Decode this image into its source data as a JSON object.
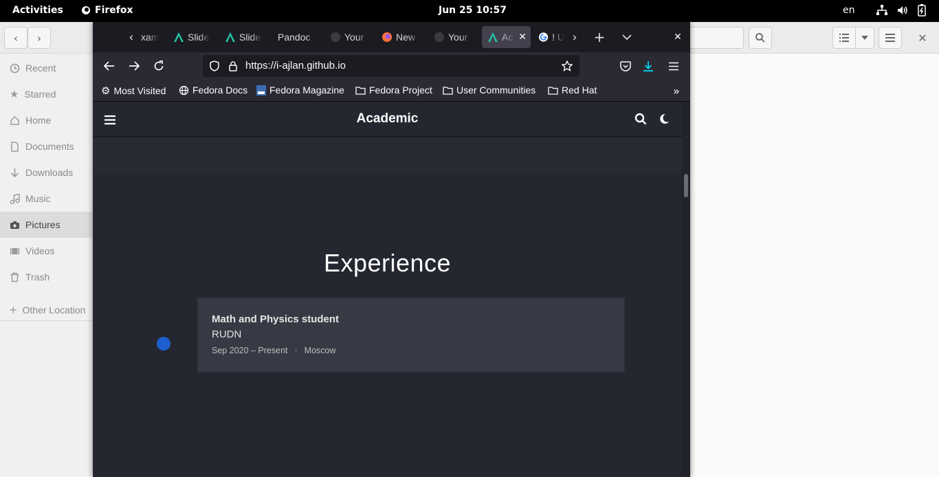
{
  "topbar": {
    "activities": "Activities",
    "app_name": "Firefox",
    "clock": "Jun 25  10:57",
    "language": "en"
  },
  "files_sidebar": {
    "items": [
      {
        "label": "Recent",
        "icon": "clock-icon"
      },
      {
        "label": "Starred",
        "icon": "star-icon"
      },
      {
        "label": "Home",
        "icon": "home-icon"
      },
      {
        "label": "Documents",
        "icon": "document-icon"
      },
      {
        "label": "Downloads",
        "icon": "download-icon"
      },
      {
        "label": "Music",
        "icon": "music-icon"
      },
      {
        "label": "Pictures",
        "icon": "camera-icon"
      },
      {
        "label": "Videos",
        "icon": "video-icon"
      },
      {
        "label": "Trash",
        "icon": "trash-icon"
      }
    ],
    "other_locations": "Other Location",
    "active_item": "Pictures"
  },
  "browser": {
    "tabs": [
      {
        "label": "xam"
      },
      {
        "label": "Slide"
      },
      {
        "label": "Slide"
      },
      {
        "label": "Pandoc"
      },
      {
        "label": "Your"
      },
      {
        "label": "New"
      },
      {
        "label": "Your"
      },
      {
        "label": "Ac"
      },
      {
        "label": "! U"
      }
    ],
    "active_tab": "Ac",
    "url": "https://i-ajlan.github.io",
    "bookmarks": [
      {
        "label": "Most Visited",
        "icon": "gear-icon"
      },
      {
        "label": "Fedora Docs",
        "icon": "globe-icon"
      },
      {
        "label": "Fedora Magazine",
        "icon": "fm-icon"
      },
      {
        "label": "Fedora Project",
        "icon": "folder-icon"
      },
      {
        "label": "User Communities",
        "icon": "folder-icon"
      },
      {
        "label": "Red Hat",
        "icon": "folder-icon"
      }
    ]
  },
  "site": {
    "title": "Academic",
    "section_title": "Experience",
    "experience": {
      "role": "Math and Physics student",
      "organization": "RUDN",
      "dates": "Sep 2020 – Present",
      "separator": "·",
      "location": "Moscow"
    }
  },
  "colors": {
    "page_bg": "#252730",
    "card_bg": "#373a44",
    "timeline_dot": "#1e5fd0",
    "download_accent": "#00ddff"
  }
}
